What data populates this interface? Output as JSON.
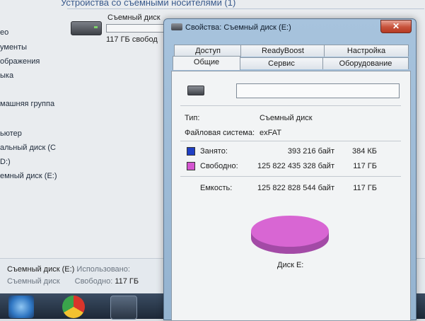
{
  "explorer": {
    "sidebar": [
      "ео",
      "ументы",
      "ображения",
      "ыка",
      "машняя группа",
      "ьютер",
      "альный диск (C",
      "D:)",
      "емный диск (E:)"
    ],
    "group_header": "Устройства со съемными носителями (1)",
    "drive_tile": {
      "name": "Съемный диск",
      "free": "117 ГБ свобод"
    },
    "status": {
      "line1_name": "Съемный диск (E:)",
      "line1_label": "Использовано:",
      "line2_name": "Съемный диск",
      "line2_label": "Свободно:",
      "line2_value": "117 ГБ"
    }
  },
  "dialog": {
    "title": "Свойства: Съемный диск (E:)",
    "close_label": "✕",
    "tabs_row1": [
      "Доступ",
      "ReadyBoost",
      "Настройка"
    ],
    "tabs_row2": [
      "Общие",
      "Сервис",
      "Оборудование"
    ],
    "active_tab": "Общие",
    "volume_label_value": "",
    "type_label": "Тип:",
    "type_value": "Съемный диск",
    "fs_label": "Файловая система:",
    "fs_value": "exFAT",
    "used": {
      "label": "Занято:",
      "bytes": "393 216 байт",
      "size": "384 КБ",
      "color": "#1f3fc4"
    },
    "free": {
      "label": "Свободно:",
      "bytes": "125 822 435 328 байт",
      "size": "117 ГБ",
      "color": "#d455d0"
    },
    "capacity": {
      "label": "Емкость:",
      "bytes": "125 822 828 544 байт",
      "size": "117 ГБ"
    },
    "disk_label": "Диск E:"
  }
}
